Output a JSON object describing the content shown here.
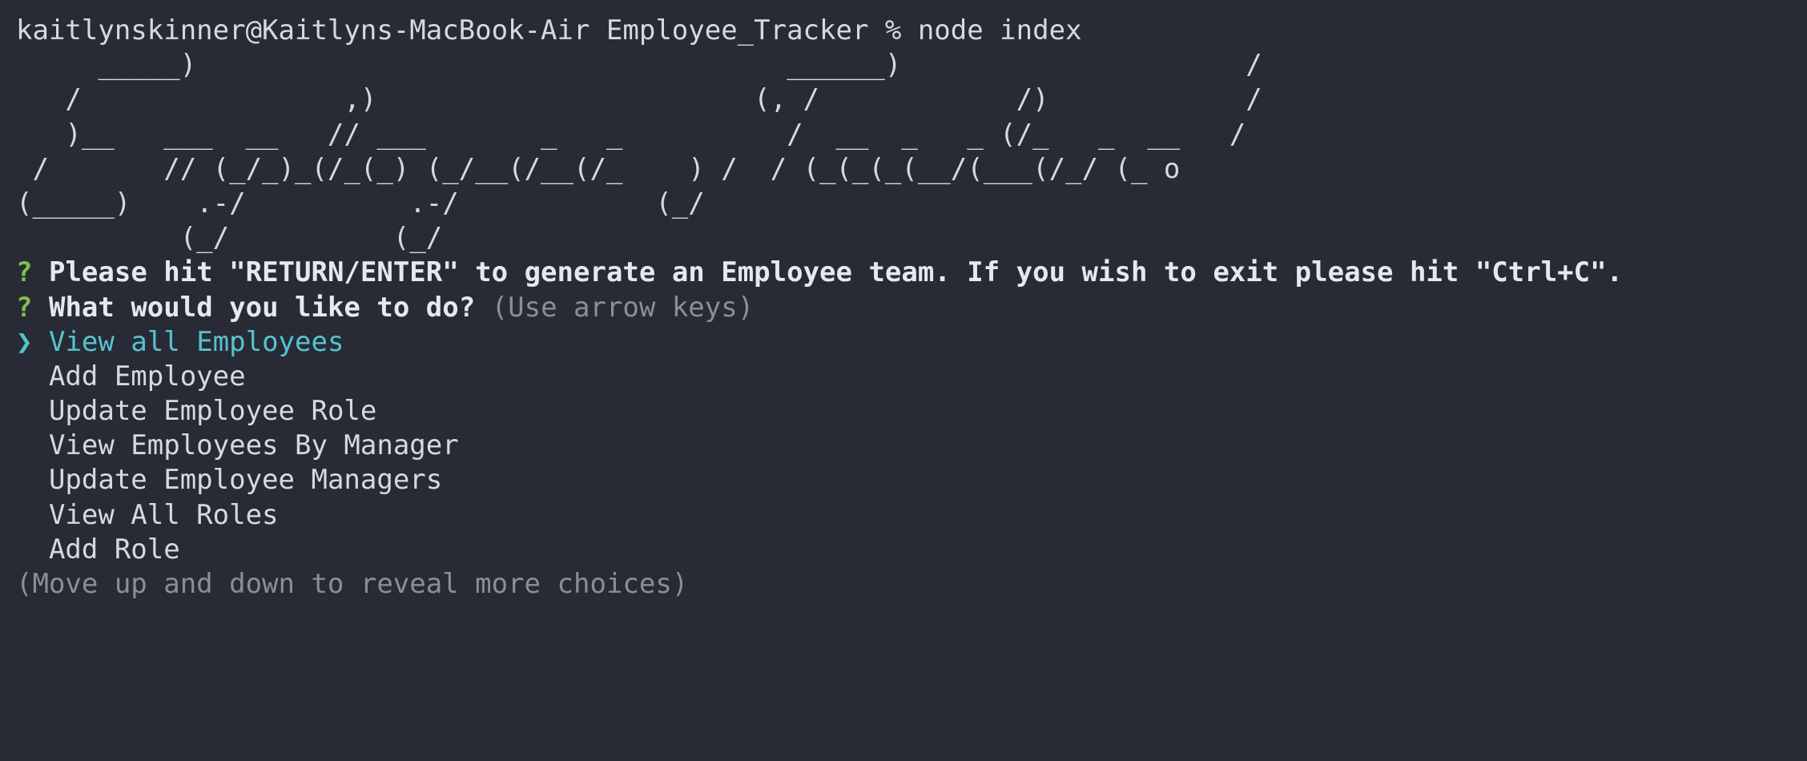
{
  "prompt_line": "kaitlynskinner@Kaitlyns-MacBook-Air Employee_Tracker % node index",
  "ascii_art": [
    "     _____)                                    ______)                     /",
    "   /                ,)                       (, /            /)            /",
    "   )__   ___  __   // ___       _   _          /  __  _   _ (/_   _  __   /",
    " /       // (_/_)_(/_(_) (_/__(/__(/_    ) /  / (_(_(_(__/(___(/_/ (_ o",
    "(_____)    .-/          .-/            (_/",
    "          (_/          (_/"
  ],
  "question_mark": "?",
  "question_1": "Please hit \"RETURN/ENTER\" to generate an Employee team. If you wish to exit please hit \"Ctrl+C\".",
  "question_2": "What would you like to do?",
  "question_2_hint": "(Use arrow keys)",
  "pointer": "❯",
  "menu": {
    "selected": "View all Employees",
    "items": [
      "Add Employee",
      "Update Employee Role",
      "View Employees By Manager",
      "Update Employee Managers",
      "View All Roles",
      "Add Role"
    ]
  },
  "footer_hint": "(Move up and down to reveal more choices)"
}
